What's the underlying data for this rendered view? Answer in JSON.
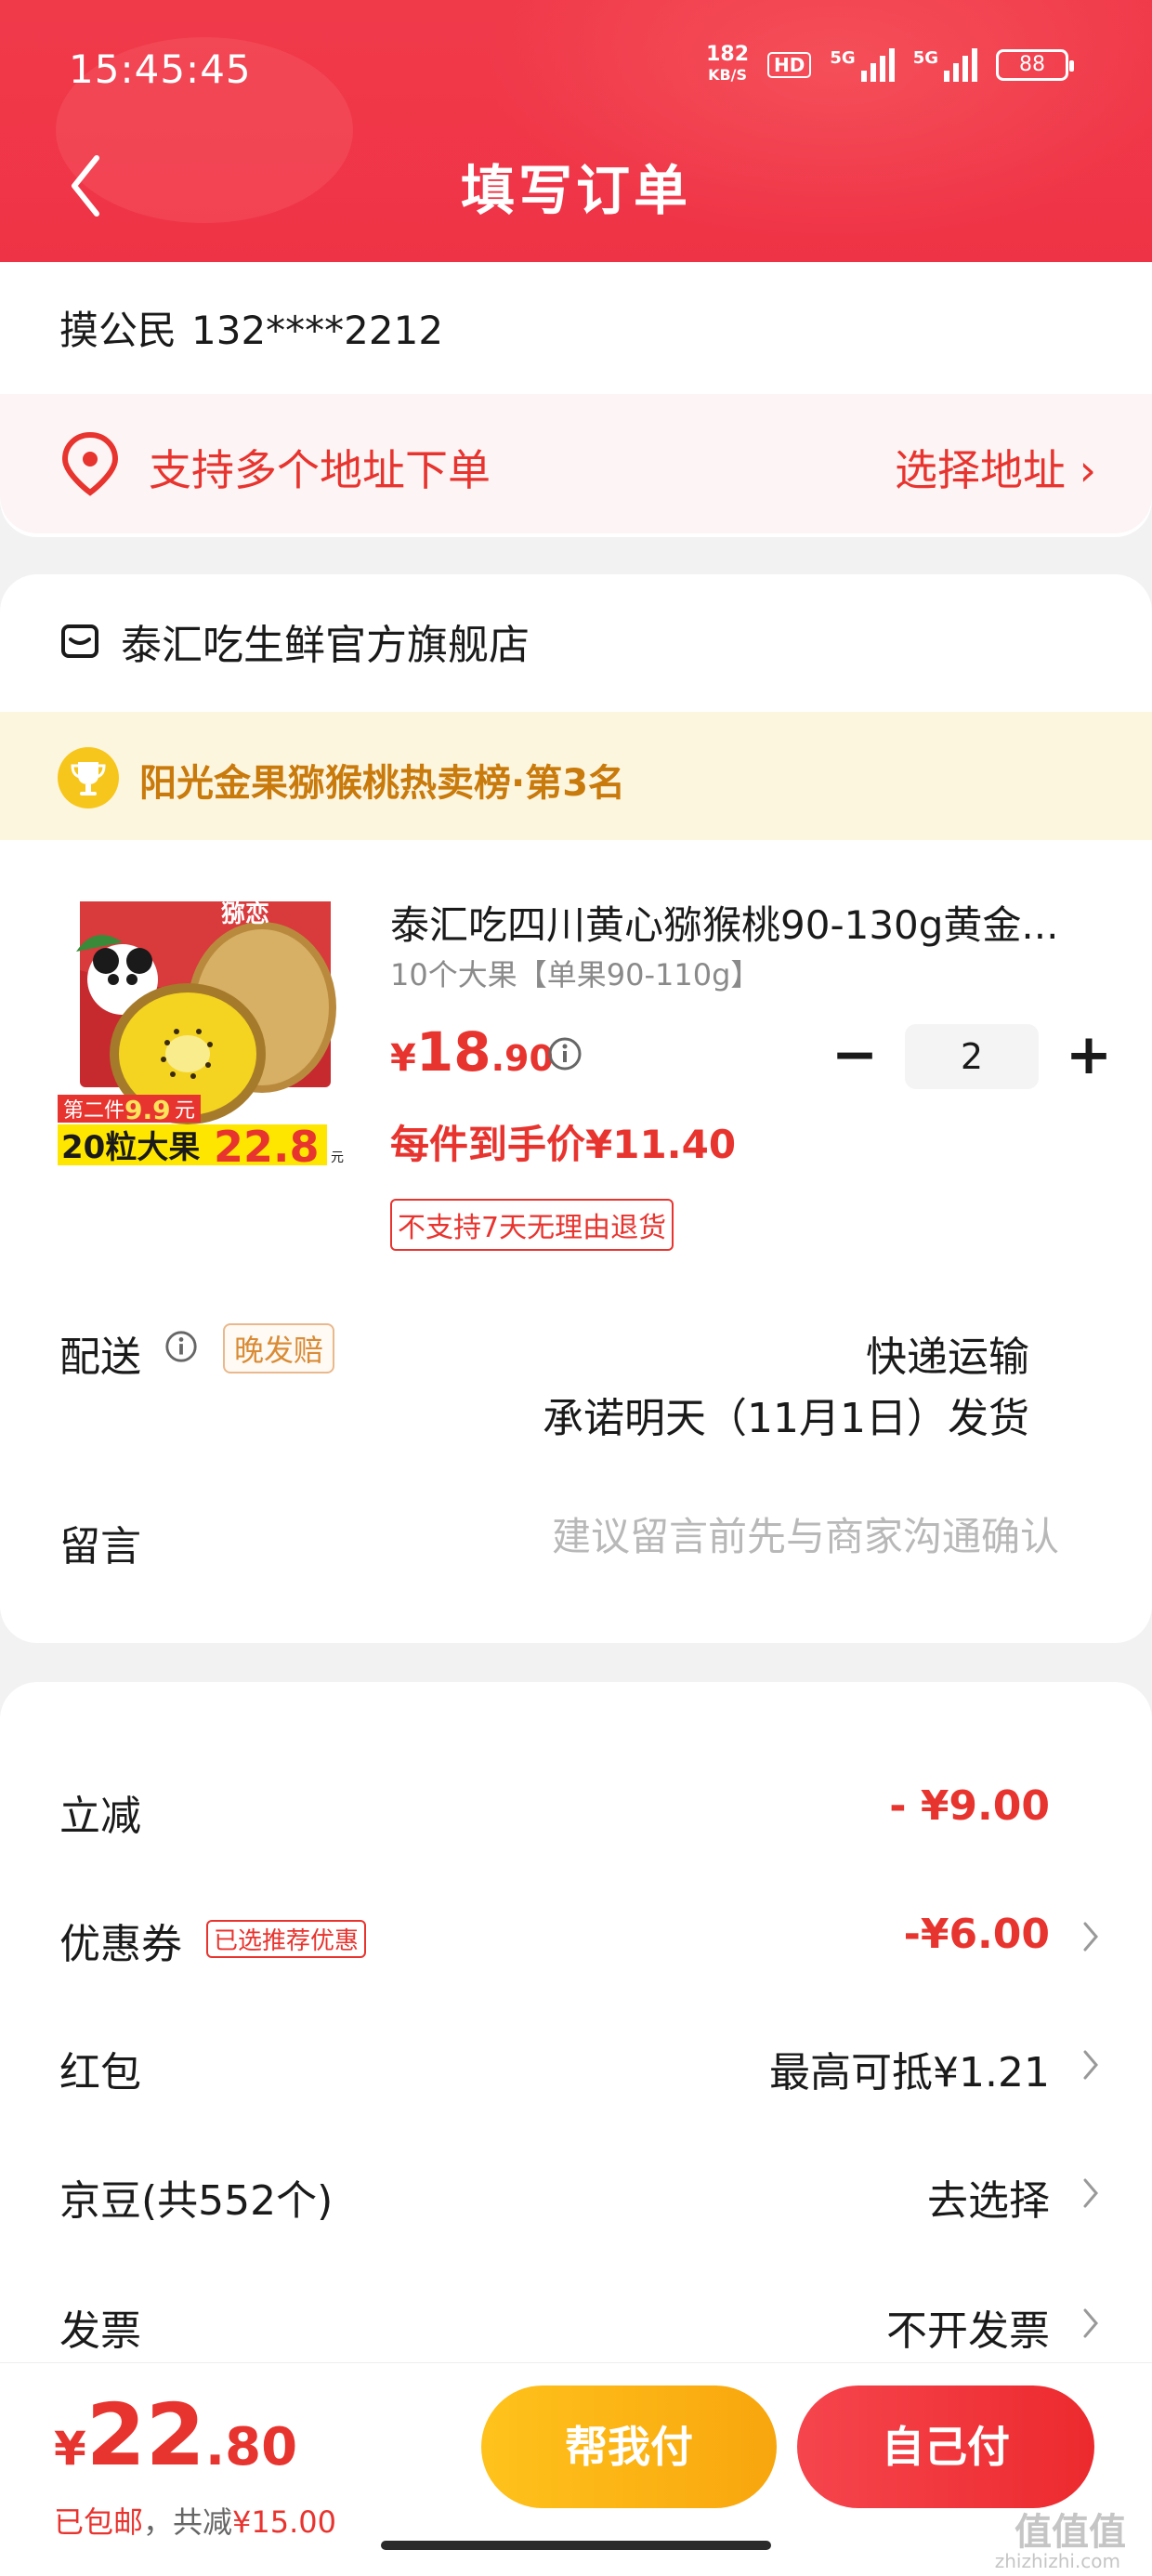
{
  "status_bar": {
    "time": "15:45:45",
    "net_speed_top": "182",
    "net_speed_unit": "KB/S",
    "hd": "HD",
    "sig1": "5G",
    "sig2": "5G",
    "battery": "88"
  },
  "header": {
    "title": "填写订单"
  },
  "address": {
    "name": "摸公民",
    "phone": "132****2212",
    "multi_text": "支持多个地址下单",
    "choose_label": "选择地址 ›"
  },
  "store": {
    "name": "泰汇吃生鲜官方旗舰店",
    "rank_text": "阳光金果猕猴桃热卖榜·第3名",
    "product": {
      "title": "泰汇吃四川黄心猕猴桃90-130g黄金...",
      "spec": "10个大果【单果90-110g】",
      "price_cur": "¥",
      "price_int": "18",
      "price_dec": ".90",
      "quantity": "2",
      "minus": "−",
      "plus": "+",
      "each_price": "每件到手价¥11.40",
      "no_return": "不支持7天无理由退货",
      "img_brand": "猕恋",
      "img_promo_line1": "第二件",
      "img_promo_price1": "9.9",
      "img_promo_unit1": "元",
      "img_promo_line2": "20粒大果",
      "img_promo_price2": "22.8",
      "img_promo_unit2": "元"
    },
    "shipping": {
      "label": "配送",
      "tag": "晚发赔",
      "method": "快递运输",
      "promise": "承诺明天（11月1日）发货"
    },
    "message": {
      "label": "留言",
      "placeholder": "建议留言前先与商家沟通确认"
    }
  },
  "summary": {
    "rows": [
      {
        "label": "立减",
        "value": "- ¥9.00"
      },
      {
        "label": "优惠券",
        "tag": "已选推荐优惠",
        "value": "-¥6.00"
      },
      {
        "label": "红包",
        "value": "最高可抵¥1.21"
      },
      {
        "label": "京豆(共552个)",
        "value": "去选择"
      },
      {
        "label": "发票",
        "value": "不开发票"
      }
    ]
  },
  "bottom": {
    "total_cur": "¥",
    "total_int": "22",
    "total_dec": ".80",
    "free_ship": "已包邮",
    "sep": "，",
    "discount_label": "共减",
    "discount_value": "¥15.00",
    "help_pay": "帮我付",
    "self_pay": "自己付"
  },
  "watermark": {
    "main": "值值值",
    "sub": "zhizhizhi.com"
  },
  "colors": {
    "brand_red": "#e8342f",
    "gold": "#f8a60d",
    "header_red": "#ef3346"
  }
}
